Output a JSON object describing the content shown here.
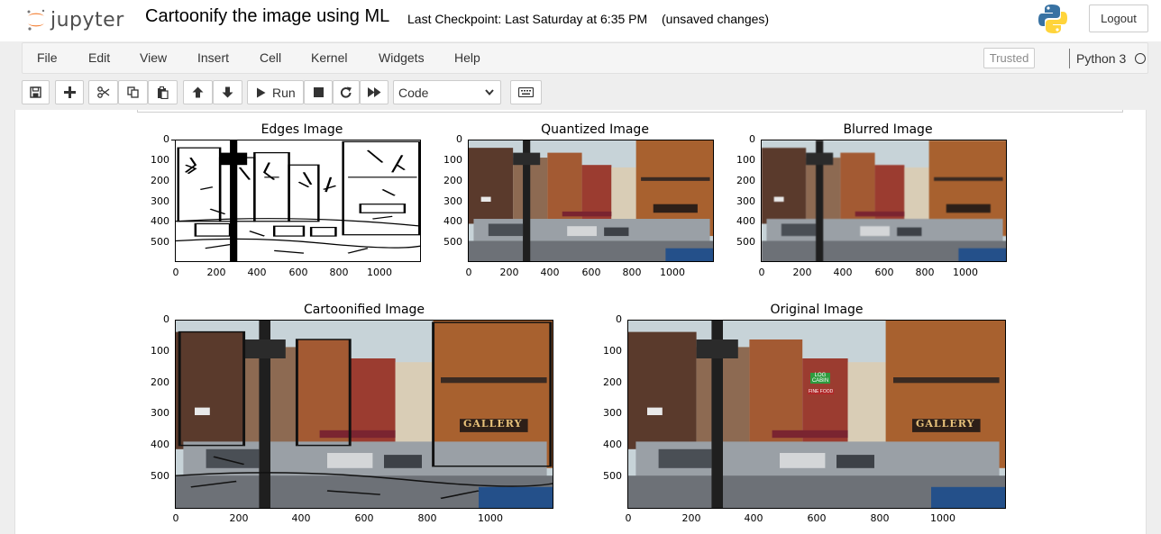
{
  "header": {
    "logo_text": "jupyter",
    "notebook_title": "Cartoonify the image using ML",
    "checkpoint": "Last Checkpoint: Last Saturday at 6:35 PM",
    "unsaved": "(unsaved changes)",
    "logout_label": "Logout"
  },
  "menubar": {
    "items": [
      "File",
      "Edit",
      "View",
      "Insert",
      "Cell",
      "Kernel",
      "Widgets",
      "Help"
    ],
    "trusted_label": "Trusted",
    "kernel_name": "Python 3"
  },
  "toolbar": {
    "run_label": "Run",
    "cell_type": "Code",
    "icons": [
      "save-icon",
      "plus-icon",
      "cut-icon",
      "copy-icon",
      "paste-icon",
      "arrow-up-icon",
      "arrow-down-icon",
      "run-icon",
      "stop-icon",
      "restart-icon",
      "fast-forward-icon",
      "keyboard-icon"
    ]
  },
  "plots": [
    {
      "title": "Edges Image",
      "image": "black-and-white edge map of a street scene",
      "y_ticks": [
        "0",
        "100",
        "200",
        "300",
        "400",
        "500"
      ],
      "x_ticks": [
        "0",
        "200",
        "400",
        "600",
        "800",
        "1000"
      ]
    },
    {
      "title": "Quantized Image",
      "image": "color-quantized street scene",
      "y_ticks": [
        "0",
        "100",
        "200",
        "300",
        "400",
        "500"
      ],
      "x_ticks": [
        "0",
        "200",
        "400",
        "600",
        "800",
        "1000"
      ]
    },
    {
      "title": "Blurred Image",
      "image": "blurred street scene",
      "y_ticks": [
        "0",
        "100",
        "200",
        "300",
        "400",
        "500"
      ],
      "x_ticks": [
        "0",
        "200",
        "400",
        "600",
        "800",
        "1000"
      ]
    },
    {
      "title": "Cartoonified Image",
      "image": "cartoon-style street scene with gallery storefront",
      "y_ticks": [
        "0",
        "100",
        "200",
        "300",
        "400",
        "500"
      ],
      "x_ticks": [
        "0",
        "200",
        "400",
        "600",
        "800",
        "1000"
      ]
    },
    {
      "title": "Original Image",
      "image": "photograph of a small-town street with shops and parked cars",
      "y_ticks": [
        "0",
        "100",
        "200",
        "300",
        "400",
        "500"
      ],
      "x_ticks": [
        "0",
        "200",
        "400",
        "600",
        "800",
        "1000"
      ]
    }
  ],
  "image_signs": {
    "gallery_sign": "GALLERY",
    "log_cabin_sign": "LOG CABIN",
    "fine_food_sign": "FINE FOOD"
  },
  "colors": {
    "jupyter_orange": "#f37726",
    "python_blue": "#3872a3",
    "python_yellow": "#ffd43b",
    "brick": "#a5552a",
    "street": "#9aa0a6"
  }
}
